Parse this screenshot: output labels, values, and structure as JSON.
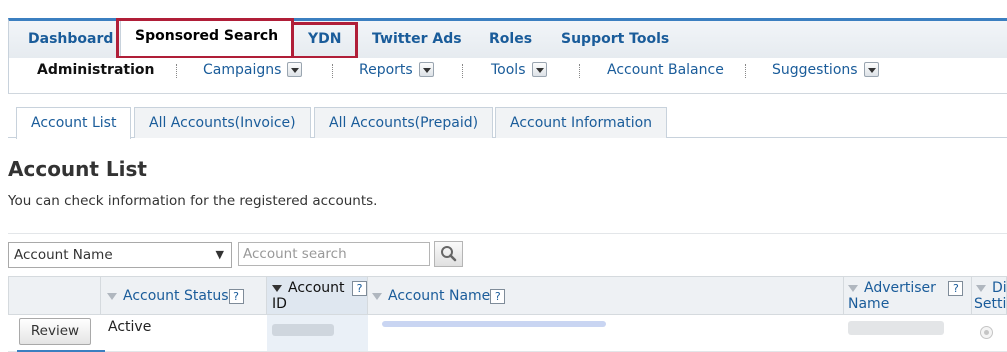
{
  "top_nav": {
    "items": [
      "Dashboard",
      "Sponsored Search",
      "YDN",
      "Twitter Ads",
      "Roles",
      "Support Tools"
    ],
    "highlight_color": "#b01e38",
    "accent_color": "#3b7fc0"
  },
  "sub_nav": {
    "items": [
      "Administration",
      "Campaigns",
      "Reports",
      "Tools",
      "Account Balance",
      "Suggestions"
    ]
  },
  "tabs": [
    "Account List",
    "All Accounts(Invoice)",
    "All Accounts(Prepaid)",
    "Account Information"
  ],
  "page": {
    "title": "Account List",
    "description": "You can check information for the registered accounts."
  },
  "search": {
    "field_select": "Account Name",
    "placeholder": "Account search"
  },
  "table": {
    "headers": {
      "account_status": "Account Status",
      "account_id_1": "Account",
      "account_id_2": "ID",
      "account_name": "Account Name",
      "advertiser_1": "Advertiser",
      "advertiser_2": "Name",
      "display_1": "Di",
      "display_2": "Setti"
    },
    "help_glyph": "?",
    "rows": [
      {
        "action": "Review",
        "status": "Active"
      }
    ]
  }
}
